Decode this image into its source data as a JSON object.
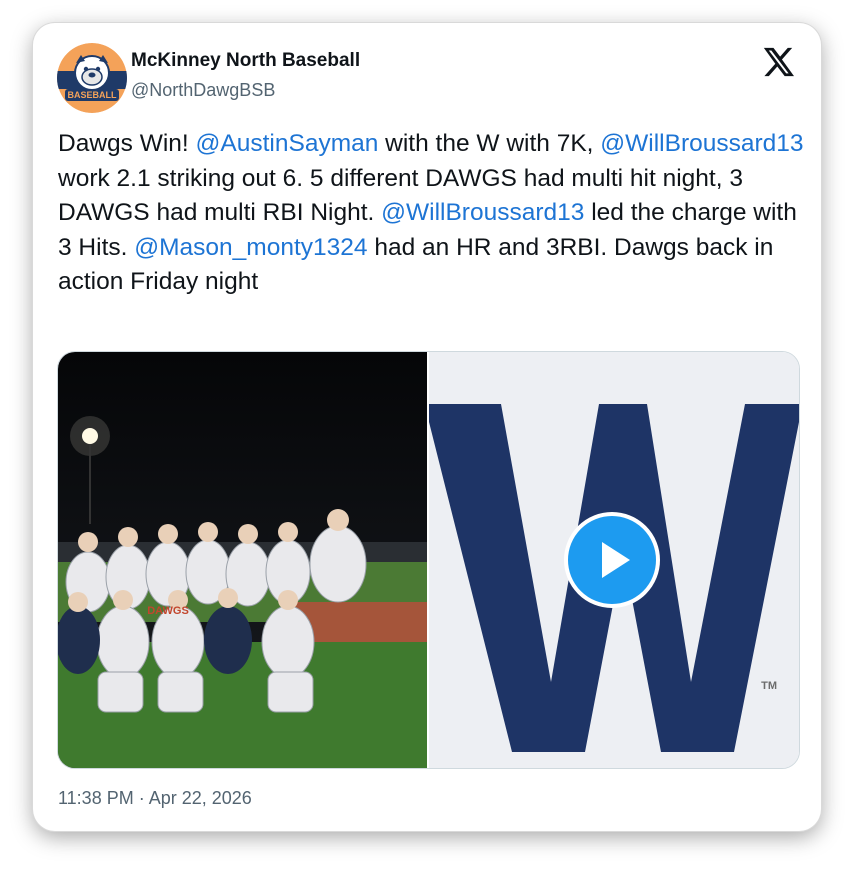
{
  "account": {
    "name": "McKinney North Baseball",
    "handle": "@NorthDawgBSB",
    "avatar_text": "BASEBALL"
  },
  "tweet": {
    "t1": "Dawgs Win!  ",
    "m1": "@AustinSayman",
    "t2": " with the W with 7K, ",
    "m2": "@WillBroussard13",
    "t3": " work 2.1 striking out 6.  5 different DAWGS had multi hit night, 3 DAWGS had multi RBI Night.  ",
    "m3": "@WillBroussard13",
    "t4": " led the charge with 3 Hits.  ",
    "m4": "@Mason_monty1324",
    "t5": " had an HR and 3RBI.  Dawgs back in action Friday night"
  },
  "media": {
    "photo_jersey": "DAWGS",
    "video_letter": "W",
    "video_mark": "TM"
  },
  "timestamp": "11:38 PM · Apr 22, 2026",
  "colors": {
    "link": "#1d74d4",
    "play": "#1d9bf0",
    "w_blue": "#1e3466"
  },
  "icons": [
    "x-logo-icon",
    "play-icon"
  ]
}
